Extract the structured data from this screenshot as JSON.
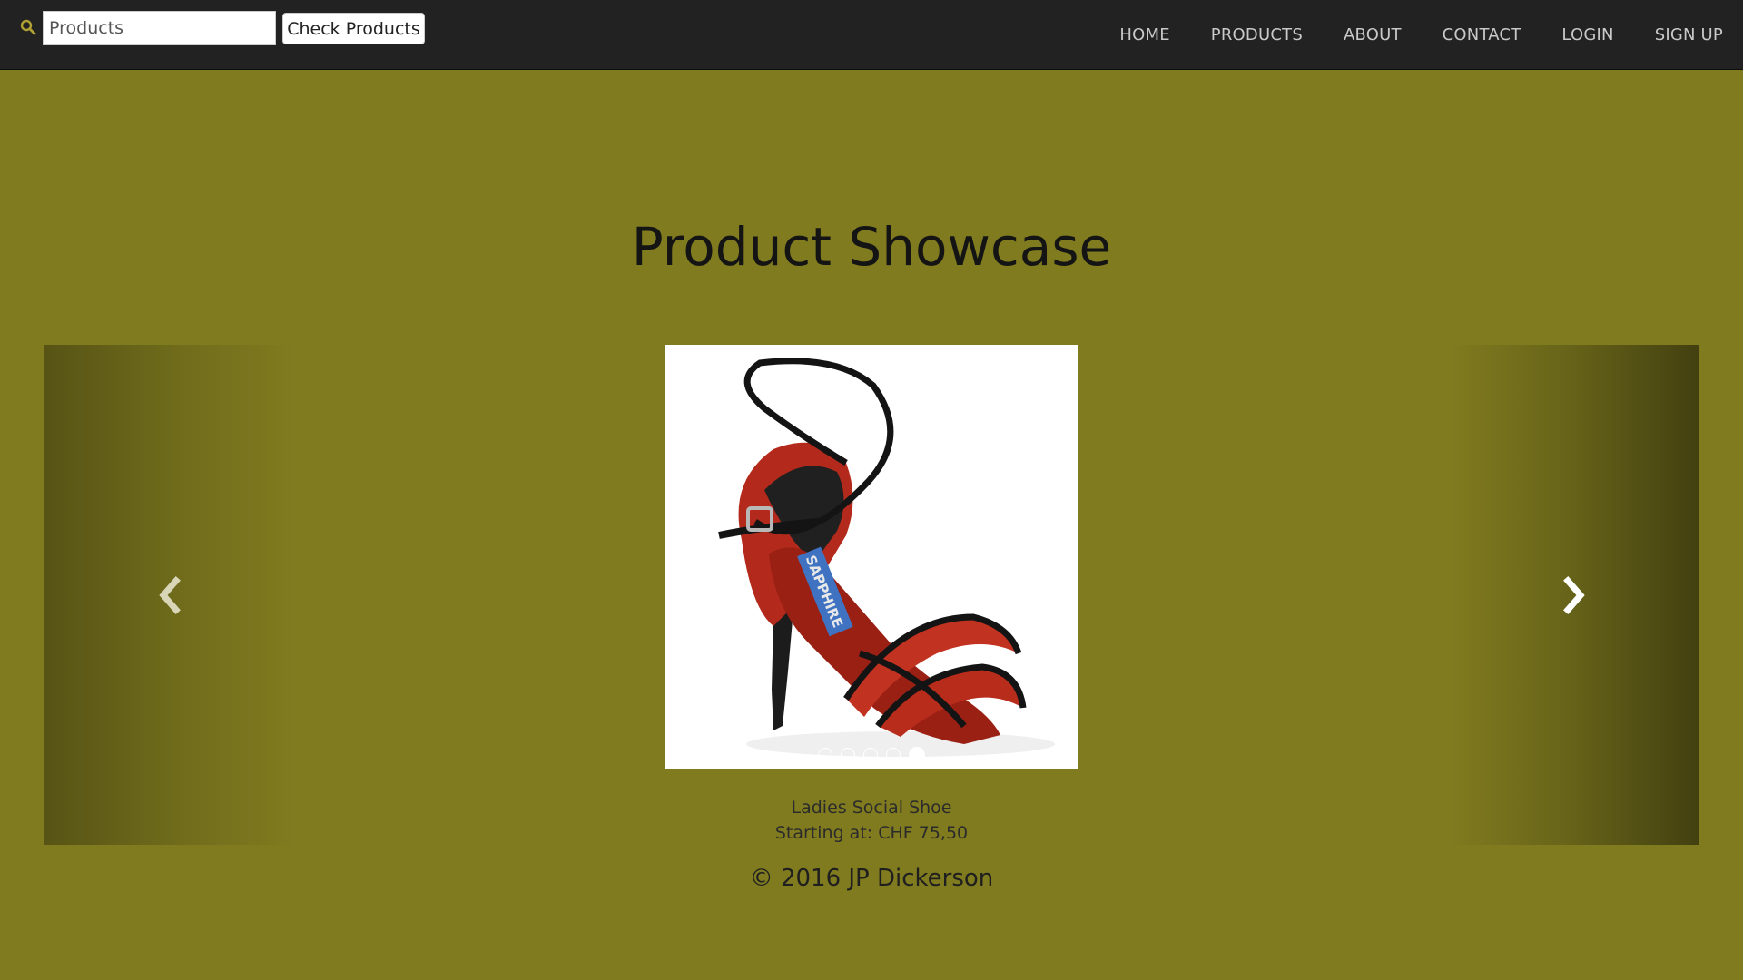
{
  "navbar": {
    "search_icon": "search-icon",
    "search_value": "Products",
    "search_placeholder": "Products",
    "check_button_label": "Check Products",
    "links": [
      "HOME",
      "PRODUCTS",
      "ABOUT",
      "CONTACT",
      "LOGIN",
      "SIGN UP"
    ]
  },
  "page": {
    "title": "Product Showcase"
  },
  "carousel": {
    "prev_icon": "chevron-left-icon",
    "next_icon": "chevron-right-icon",
    "indicator_count": 5,
    "active_indicator": 5,
    "product_name": "Ladies Social Shoe",
    "price_line": "Starting at: CHF 75,50",
    "image_brand_text": "SAPPHIRE"
  },
  "footer": {
    "copyright": "© 2016 JP Dickerson"
  },
  "colors": {
    "background": "#807b1f",
    "navbar": "#222222",
    "nav_link": "#c9c9c9"
  }
}
